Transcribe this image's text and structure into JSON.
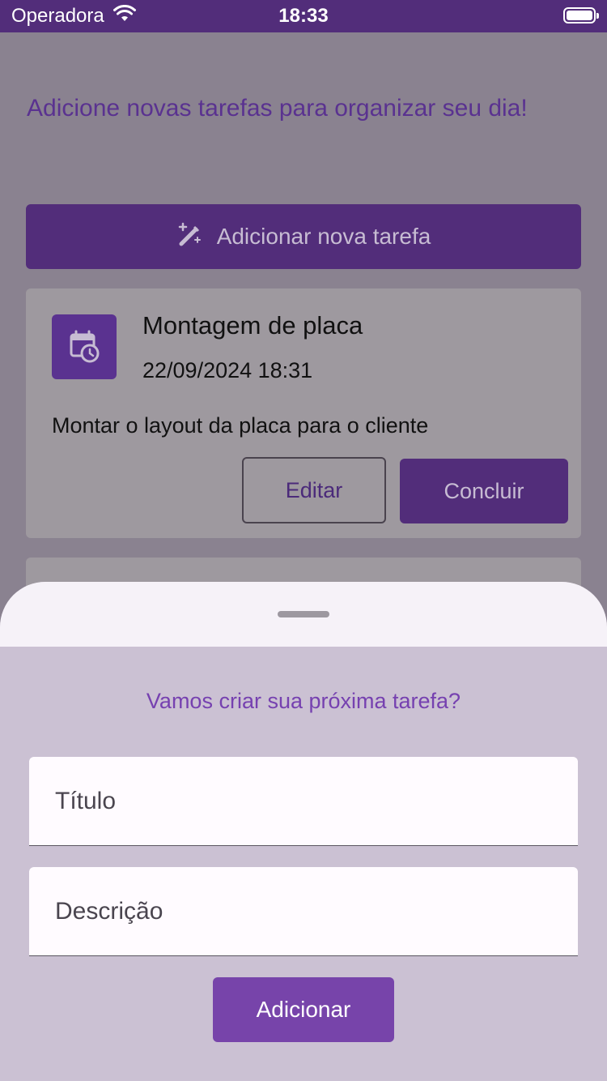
{
  "status_bar": {
    "carrier": "Operadora",
    "time": "18:33"
  },
  "intro_text": "Adicione novas tarefas para organizar seu dia!",
  "add_task_button": {
    "label": "Adicionar nova tarefa",
    "icon": "magic-wand-icon"
  },
  "tasks": [
    {
      "icon": "calendar-clock-icon",
      "title": "Montagem de placa",
      "datetime": "22/09/2024 18:31",
      "description": "Montar o layout da placa para o cliente",
      "edit_label": "Editar",
      "conclude_label": "Concluir"
    }
  ],
  "sheet": {
    "heading": "Vamos criar sua próxima tarefa?",
    "title_field": {
      "placeholder": "Título",
      "value": ""
    },
    "description_field": {
      "placeholder": "Descrição",
      "value": ""
    },
    "submit_label": "Adicionar"
  },
  "colors": {
    "primary": "#522d7a",
    "accent": "#7744aa",
    "heading": "#7641b0"
  }
}
